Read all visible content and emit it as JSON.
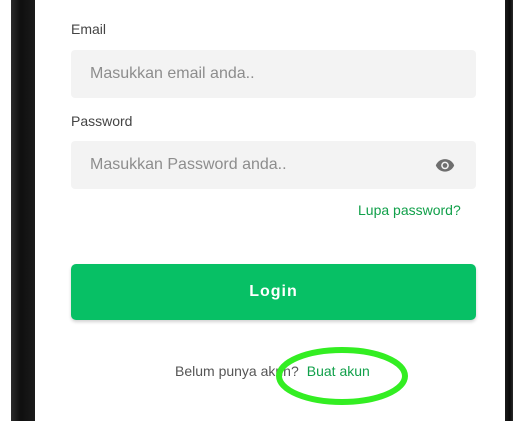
{
  "form": {
    "email_label": "Email",
    "email_placeholder": "Masukkan email anda..",
    "password_label": "Password",
    "password_placeholder": "Masukkan Password anda..",
    "password_toggle_icon": "eye-icon",
    "forgot_password": "Lupa password?",
    "login_button": "Login"
  },
  "signup": {
    "prompt": "Belum punya akun?",
    "link": "Buat akun"
  },
  "colors": {
    "accent": "#07c065",
    "link": "#11a04a",
    "annotation": "#33ee22"
  }
}
